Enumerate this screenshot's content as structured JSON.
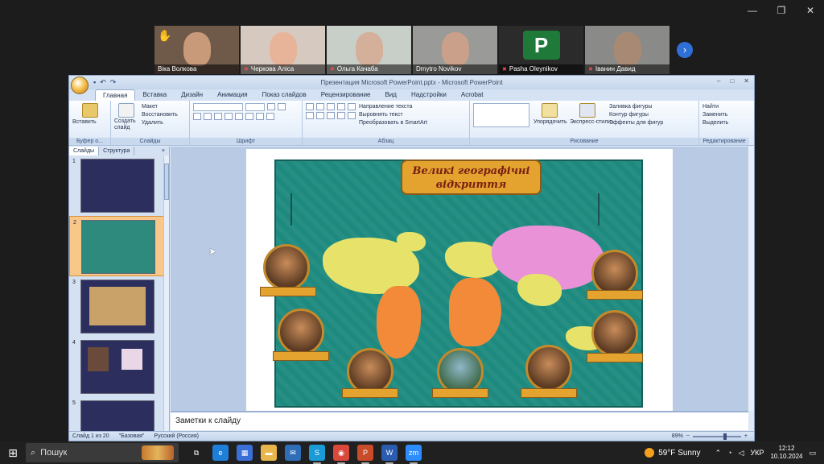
{
  "window_controls": {
    "minimize": "—",
    "maximize": "❐",
    "close": "✕"
  },
  "participants": [
    {
      "name": "Віка Волкова",
      "muted": false,
      "hand_raised": true,
      "tone": "#c99a7a",
      "bg": "#6f5a4a"
    },
    {
      "name": "Черкова Аліса",
      "muted": true,
      "hand_raised": false,
      "tone": "#e7b49a",
      "bg": "#d6c9c0"
    },
    {
      "name": "Ольга Качаба",
      "muted": true,
      "hand_raised": false,
      "tone": "#d4b09a",
      "bg": "#c8cec8"
    },
    {
      "name": "Dmytro Novikov",
      "muted": false,
      "hand_raised": false,
      "tone": "#caa08a",
      "bg": "#9a9a98",
      "active": true
    },
    {
      "name": "Pasha Oleynikov",
      "muted": true,
      "hand_raised": false,
      "avatar_letter": "P"
    },
    {
      "name": "Іванин Давид",
      "muted": true,
      "hand_raised": false,
      "tone": "#a88a74",
      "bg": "#8a8a88"
    }
  ],
  "ppt": {
    "title": "Презентация Microsoft PowerPoint.pptx - Microsoft PowerPoint",
    "tabs": [
      "Главная",
      "Вставка",
      "Дизайн",
      "Анимация",
      "Показ слайдов",
      "Рецензирование",
      "Вид",
      "Надстройки",
      "Acrobat"
    ],
    "active_tab": "Главная",
    "ribbon": {
      "clipboard": {
        "paste": "Вставить",
        "label": "Буфер о..."
      },
      "slides": {
        "create": "Создать слайд",
        "layout": "Макет",
        "reset": "Восстановить",
        "delete": "Удалить",
        "label": "Слайды"
      },
      "font": {
        "label": "Шрифт"
      },
      "paragraph": {
        "text_dir": "Направление текста",
        "align_text": "Выровнять текст",
        "smartart": "Преобразовать в SmartArt",
        "label": "Абзац"
      },
      "drawing": {
        "arrange": "Упорядочить",
        "quick_styles": "Экспресс-стили",
        "fill": "Заливка фигуры",
        "outline": "Контур фигуры",
        "effects": "Эффекты для фигур",
        "label": "Рисование"
      },
      "editing": {
        "find": "Найти",
        "replace": "Заменить",
        "select": "Выделить",
        "label": "Редактирование"
      }
    },
    "panel_tabs": {
      "slides": "Слайды",
      "outline": "Структура"
    },
    "thumbnails": [
      "1",
      "2",
      "3",
      "4",
      "5"
    ],
    "selected_slide": 2,
    "slide": {
      "banner": "Великі географічні відкриття"
    },
    "notes_placeholder": "Заметки к слайду",
    "status": {
      "slide": "Слайд 1 из 20",
      "theme": "\"Базовая\"",
      "language": "Русский (Россия)",
      "zoom": "89%"
    }
  },
  "taskbar": {
    "search_placeholder": "Пошук",
    "weather": "59°F  Sunny",
    "language": "УКР",
    "time": "12:12",
    "date": "10.10.2024",
    "apps": [
      {
        "name": "task-view",
        "color": "#202020",
        "glyph": "⧉"
      },
      {
        "name": "edge",
        "color": "#1f7fd8",
        "glyph": "e"
      },
      {
        "name": "store",
        "color": "#3a6fd8",
        "glyph": "▦"
      },
      {
        "name": "explorer",
        "color": "#e8b64a",
        "glyph": "▬"
      },
      {
        "name": "mail",
        "color": "#2e6db8",
        "glyph": "✉"
      },
      {
        "name": "skype",
        "color": "#1a9ad6",
        "glyph": "S"
      },
      {
        "name": "chrome",
        "color": "#d9483b",
        "glyph": "◉"
      },
      {
        "name": "powerpoint",
        "color": "#c84b2a",
        "glyph": "P"
      },
      {
        "name": "word",
        "color": "#2b5cb0",
        "glyph": "W"
      },
      {
        "name": "zoom",
        "color": "#2d8cff",
        "glyph": "zm"
      }
    ]
  }
}
